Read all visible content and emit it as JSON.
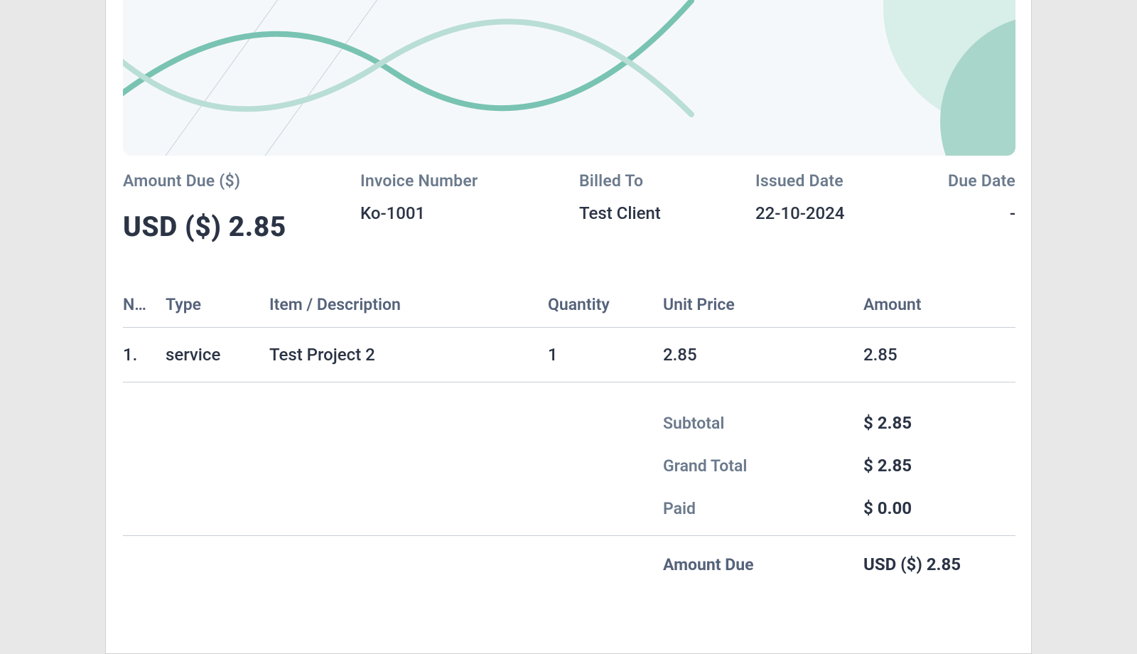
{
  "meta": {
    "amount_due_label": "Amount Due ($)",
    "amount_due_value": "USD ($) 2.85",
    "invoice_number_label": "Invoice Number",
    "invoice_number_value": "Ko-1001",
    "billed_to_label": "Billed To",
    "billed_to_value": "Test Client",
    "issued_date_label": "Issued Date",
    "issued_date_value": "22-10-2024",
    "due_date_label": "Due Date",
    "due_date_value": "-"
  },
  "table": {
    "headers": {
      "no": "N…",
      "type": "Type",
      "item": "Item / Description",
      "qty": "Quantity",
      "price": "Unit Price",
      "amount": "Amount"
    },
    "rows": [
      {
        "no": "1.",
        "type": "service",
        "item": "Test Project 2",
        "qty": "1",
        "price": "2.85",
        "amount": "2.85"
      }
    ]
  },
  "totals": {
    "subtotal_label": "Subtotal",
    "subtotal_value": "$ 2.85",
    "grand_total_label": "Grand Total",
    "grand_total_value": "$ 2.85",
    "paid_label": "Paid",
    "paid_value": "$ 0.00",
    "amount_due_label": "Amount Due",
    "amount_due_value": "USD ($) 2.85"
  }
}
